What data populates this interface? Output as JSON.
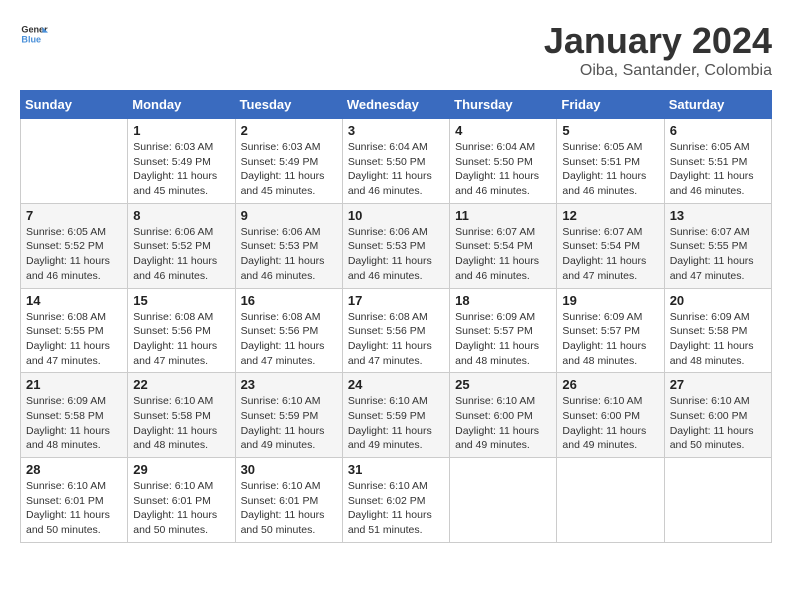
{
  "logo": {
    "line1": "General",
    "line2": "Blue"
  },
  "title": "January 2024",
  "location": "Oiba, Santander, Colombia",
  "days_of_week": [
    "Sunday",
    "Monday",
    "Tuesday",
    "Wednesday",
    "Thursday",
    "Friday",
    "Saturday"
  ],
  "weeks": [
    [
      {
        "day": "",
        "info": ""
      },
      {
        "day": "1",
        "info": "Sunrise: 6:03 AM\nSunset: 5:49 PM\nDaylight: 11 hours\nand 45 minutes."
      },
      {
        "day": "2",
        "info": "Sunrise: 6:03 AM\nSunset: 5:49 PM\nDaylight: 11 hours\nand 45 minutes."
      },
      {
        "day": "3",
        "info": "Sunrise: 6:04 AM\nSunset: 5:50 PM\nDaylight: 11 hours\nand 46 minutes."
      },
      {
        "day": "4",
        "info": "Sunrise: 6:04 AM\nSunset: 5:50 PM\nDaylight: 11 hours\nand 46 minutes."
      },
      {
        "day": "5",
        "info": "Sunrise: 6:05 AM\nSunset: 5:51 PM\nDaylight: 11 hours\nand 46 minutes."
      },
      {
        "day": "6",
        "info": "Sunrise: 6:05 AM\nSunset: 5:51 PM\nDaylight: 11 hours\nand 46 minutes."
      }
    ],
    [
      {
        "day": "7",
        "info": "Sunrise: 6:05 AM\nSunset: 5:52 PM\nDaylight: 11 hours\nand 46 minutes."
      },
      {
        "day": "8",
        "info": "Sunrise: 6:06 AM\nSunset: 5:52 PM\nDaylight: 11 hours\nand 46 minutes."
      },
      {
        "day": "9",
        "info": "Sunrise: 6:06 AM\nSunset: 5:53 PM\nDaylight: 11 hours\nand 46 minutes."
      },
      {
        "day": "10",
        "info": "Sunrise: 6:06 AM\nSunset: 5:53 PM\nDaylight: 11 hours\nand 46 minutes."
      },
      {
        "day": "11",
        "info": "Sunrise: 6:07 AM\nSunset: 5:54 PM\nDaylight: 11 hours\nand 46 minutes."
      },
      {
        "day": "12",
        "info": "Sunrise: 6:07 AM\nSunset: 5:54 PM\nDaylight: 11 hours\nand 47 minutes."
      },
      {
        "day": "13",
        "info": "Sunrise: 6:07 AM\nSunset: 5:55 PM\nDaylight: 11 hours\nand 47 minutes."
      }
    ],
    [
      {
        "day": "14",
        "info": "Sunrise: 6:08 AM\nSunset: 5:55 PM\nDaylight: 11 hours\nand 47 minutes."
      },
      {
        "day": "15",
        "info": "Sunrise: 6:08 AM\nSunset: 5:56 PM\nDaylight: 11 hours\nand 47 minutes."
      },
      {
        "day": "16",
        "info": "Sunrise: 6:08 AM\nSunset: 5:56 PM\nDaylight: 11 hours\nand 47 minutes."
      },
      {
        "day": "17",
        "info": "Sunrise: 6:08 AM\nSunset: 5:56 PM\nDaylight: 11 hours\nand 47 minutes."
      },
      {
        "day": "18",
        "info": "Sunrise: 6:09 AM\nSunset: 5:57 PM\nDaylight: 11 hours\nand 48 minutes."
      },
      {
        "day": "19",
        "info": "Sunrise: 6:09 AM\nSunset: 5:57 PM\nDaylight: 11 hours\nand 48 minutes."
      },
      {
        "day": "20",
        "info": "Sunrise: 6:09 AM\nSunset: 5:58 PM\nDaylight: 11 hours\nand 48 minutes."
      }
    ],
    [
      {
        "day": "21",
        "info": "Sunrise: 6:09 AM\nSunset: 5:58 PM\nDaylight: 11 hours\nand 48 minutes."
      },
      {
        "day": "22",
        "info": "Sunrise: 6:10 AM\nSunset: 5:58 PM\nDaylight: 11 hours\nand 48 minutes."
      },
      {
        "day": "23",
        "info": "Sunrise: 6:10 AM\nSunset: 5:59 PM\nDaylight: 11 hours\nand 49 minutes."
      },
      {
        "day": "24",
        "info": "Sunrise: 6:10 AM\nSunset: 5:59 PM\nDaylight: 11 hours\nand 49 minutes."
      },
      {
        "day": "25",
        "info": "Sunrise: 6:10 AM\nSunset: 6:00 PM\nDaylight: 11 hours\nand 49 minutes."
      },
      {
        "day": "26",
        "info": "Sunrise: 6:10 AM\nSunset: 6:00 PM\nDaylight: 11 hours\nand 49 minutes."
      },
      {
        "day": "27",
        "info": "Sunrise: 6:10 AM\nSunset: 6:00 PM\nDaylight: 11 hours\nand 50 minutes."
      }
    ],
    [
      {
        "day": "28",
        "info": "Sunrise: 6:10 AM\nSunset: 6:01 PM\nDaylight: 11 hours\nand 50 minutes."
      },
      {
        "day": "29",
        "info": "Sunrise: 6:10 AM\nSunset: 6:01 PM\nDaylight: 11 hours\nand 50 minutes."
      },
      {
        "day": "30",
        "info": "Sunrise: 6:10 AM\nSunset: 6:01 PM\nDaylight: 11 hours\nand 50 minutes."
      },
      {
        "day": "31",
        "info": "Sunrise: 6:10 AM\nSunset: 6:02 PM\nDaylight: 11 hours\nand 51 minutes."
      },
      {
        "day": "",
        "info": ""
      },
      {
        "day": "",
        "info": ""
      },
      {
        "day": "",
        "info": ""
      }
    ]
  ]
}
